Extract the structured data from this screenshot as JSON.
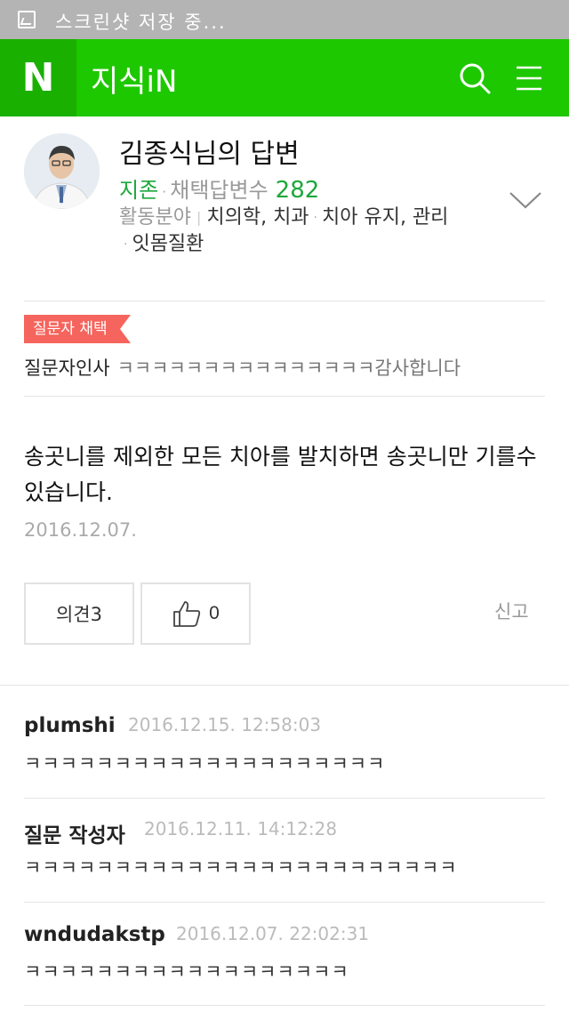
{
  "status_bar": {
    "text": "스크린샷 저장 중..."
  },
  "header": {
    "logo": "N",
    "title": "지식iN"
  },
  "profile": {
    "name": "김종식님의 답변",
    "rank": "지존",
    "adopt_label": "채택답변수",
    "adopt_count": "282",
    "field_label": "활동분야",
    "field_1": "치의학, 치과",
    "field_2": "치아 유지, 관리",
    "field_3": "잇몸질환"
  },
  "adoption": {
    "badge": "질문자 채택",
    "thanks_label": "질문자인사",
    "thanks_text": "ㅋㅋㅋㅋㅋㅋㅋㅋㅋㅋㅋㅋㅋㅋㅋ감사합니다"
  },
  "answer": {
    "text": "송곳니를 제외한 모든 치아를 발치하면 송곳니만 기를수 있습니다.",
    "date": "2016.12.07."
  },
  "actions": {
    "opinion_label": "의견3",
    "like_count": "0",
    "report_label": "신고"
  },
  "comments": [
    {
      "author": "plumshi",
      "date": "2016.12.15. 12:58:03",
      "text": "ㅋㅋㅋㅋㅋㅋㅋㅋㅋㅋㅋㅋㅋㅋㅋㅋㅋㅋㅋㅋ"
    },
    {
      "author": "질문 작성자",
      "date": "2016.12.11. 14:12:28",
      "text": "ㅋㅋㅋㅋㅋㅋㅋㅋㅋㅋㅋㅋㅋㅋㅋㅋㅋㅋㅋㅋㅋㅋㅋㅋ"
    },
    {
      "author": "wndudakstp",
      "date": "2016.12.07. 22:02:31",
      "text": "ㅋㅋㅋㅋㅋㅋㅋㅋㅋㅋㅋㅋㅋㅋㅋㅋㅋㅋ"
    }
  ]
}
